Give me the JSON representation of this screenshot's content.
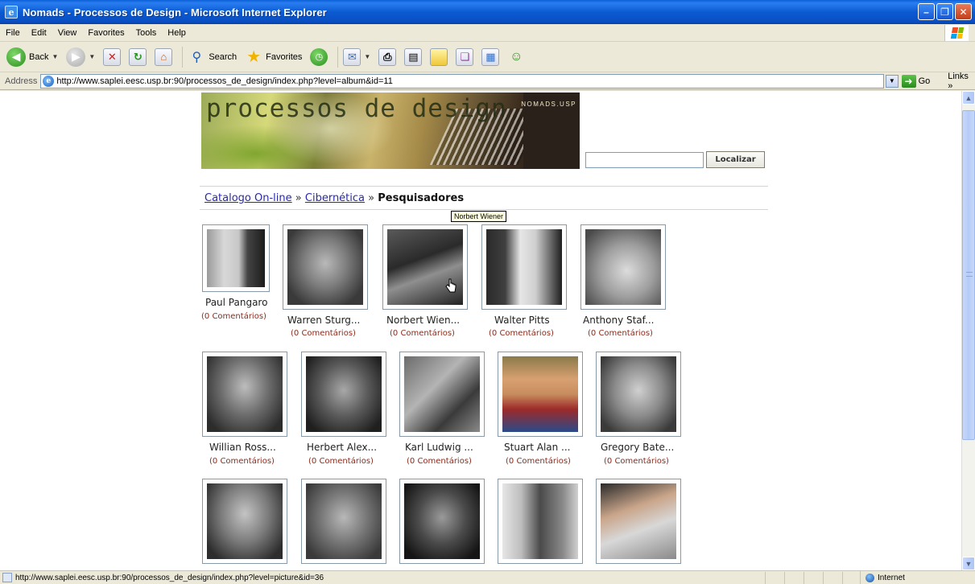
{
  "window": {
    "title": "Nomads - Processos de Design - Microsoft Internet Explorer",
    "app_icon": "ie-document-icon",
    "buttons": [
      "minimize",
      "maximize",
      "close"
    ]
  },
  "menubar": {
    "items": [
      "File",
      "Edit",
      "View",
      "Favorites",
      "Tools",
      "Help"
    ]
  },
  "toolbar": {
    "back_label": "Back",
    "search_label": "Search",
    "favorites_label": "Favorites"
  },
  "addressbar": {
    "label": "Address",
    "url": "http://www.saplei.eesc.usp.br:90/processos_de_design/index.php?level=album&id=11",
    "go_label": "Go",
    "links_label": "Links »"
  },
  "banner": {
    "logo_text": "processos de design",
    "brand": "NOMADS.USP"
  },
  "search": {
    "value": "",
    "button_label": "Localizar"
  },
  "breadcrumb": {
    "items": [
      {
        "label": "Catalogo On-line",
        "link": true
      },
      {
        "label": "Cibernética",
        "link": true
      },
      {
        "label": "Pesquisadores",
        "link": false
      }
    ],
    "separator": "»"
  },
  "gallery": {
    "rows": [
      [
        {
          "name": "Paul Pangaro",
          "comments": "(0 Comentários)"
        },
        {
          "name": "Warren Sturg...",
          "comments": "(0 Comentários)"
        },
        {
          "name": "Norbert Wien...",
          "comments": "(0 Comentários)"
        },
        {
          "name": "Walter Pitts",
          "comments": "(0 Comentários)"
        },
        {
          "name": "Anthony Staf...",
          "comments": "(0 Comentários)"
        }
      ],
      [
        {
          "name": "Willian Ross...",
          "comments": "(0 Comentários)"
        },
        {
          "name": "Herbert Alex...",
          "comments": "(0 Comentários)"
        },
        {
          "name": "Karl Ludwig ...",
          "comments": "(0 Comentários)"
        },
        {
          "name": "Stuart Alan ...",
          "comments": "(0 Comentários)"
        },
        {
          "name": "Gregory Bate...",
          "comments": "(0 Comentários)"
        }
      ],
      [
        {
          "name": "",
          "comments": ""
        },
        {
          "name": "",
          "comments": ""
        },
        {
          "name": "",
          "comments": ""
        },
        {
          "name": "",
          "comments": ""
        },
        {
          "name": "",
          "comments": ""
        }
      ]
    ]
  },
  "tooltip": {
    "text": "Norbert Wiener"
  },
  "statusbar": {
    "url": "http://www.saplei.eesc.usp.br:90/processos_de_design/index.php?level=picture&id=36",
    "zone": "Internet"
  }
}
